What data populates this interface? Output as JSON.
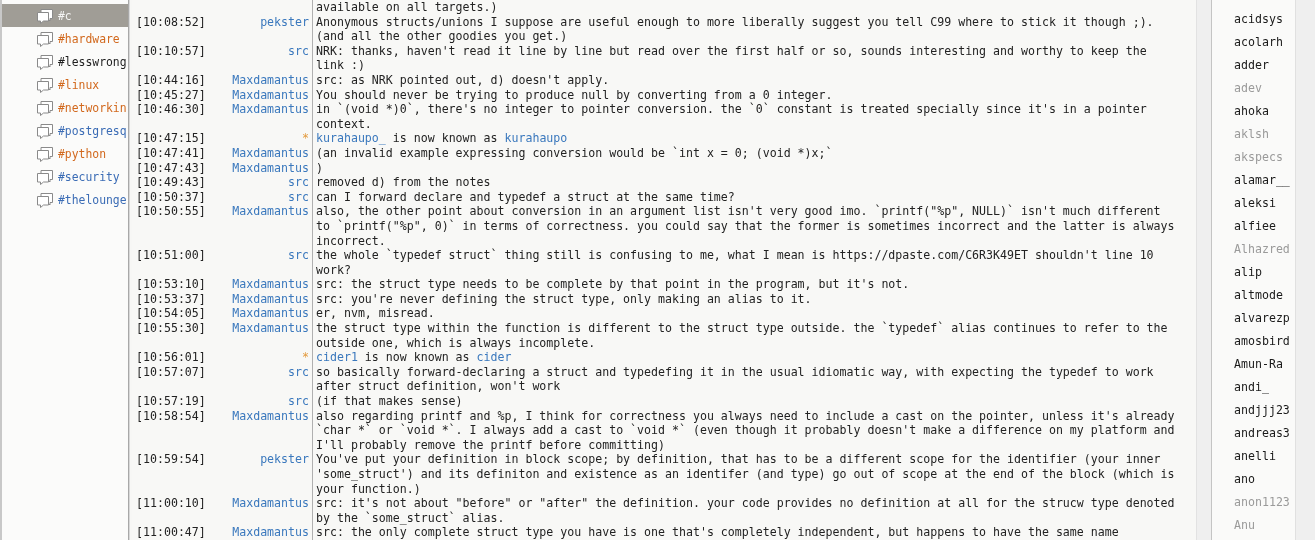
{
  "channels": [
    {
      "name": "#c",
      "selected": true
    },
    {
      "name": "#hardware",
      "selected": false,
      "color": "#d2691e"
    },
    {
      "name": "#lesswrong",
      "selected": false,
      "color": "#1e1e1e"
    },
    {
      "name": "#linux",
      "selected": false,
      "color": "#d2691e"
    },
    {
      "name": "#networkin",
      "selected": false,
      "color": "#d2691e"
    },
    {
      "name": "#postgresq",
      "selected": false,
      "color": "#3b6cb5"
    },
    {
      "name": "#python",
      "selected": false,
      "color": "#d2691e"
    },
    {
      "name": "#security",
      "selected": false,
      "color": "#3b6cb5"
    },
    {
      "name": "#thelounge",
      "selected": false,
      "color": "#3b6cb5"
    }
  ],
  "messages": [
    {
      "kind": "continuation",
      "text": "available on all targets.)"
    },
    {
      "kind": "message",
      "time": "[10:08:52]",
      "nick": "pekster",
      "text": "Anonymous structs/unions I suppose are useful enough to more liberally suggest you tell C99 where to stick it though ;). (and all the other goodies you get.)"
    },
    {
      "kind": "message",
      "time": "[10:10:57]",
      "nick": "src",
      "text": "NRK: thanks, haven't read it line by line but read over the first half or so, sounds interesting and worthy to keep the link :)"
    },
    {
      "kind": "message",
      "time": "[10:44:16]",
      "nick": "Maxdamantus",
      "text": "src: as NRK pointed out, d) doesn't apply."
    },
    {
      "kind": "message",
      "time": "[10:45:27]",
      "nick": "Maxdamantus",
      "text": "You should never be trying to produce null by converting from a 0 integer."
    },
    {
      "kind": "message",
      "time": "[10:46:30]",
      "nick": "Maxdamantus",
      "text": "in `(void *)0`, there's no integer to pointer conversion. the `0` constant is treated specially since it's in a pointer context."
    },
    {
      "kind": "nick_change",
      "time": "[10:47:15]",
      "nick": "*",
      "old": "kurahaupo_",
      "middle": "is now known as",
      "new": "kurahaupo"
    },
    {
      "kind": "message",
      "time": "[10:47:41]",
      "nick": "Maxdamantus",
      "text": "(an invalid example expressing conversion would be `int x = 0; (void *)x;`"
    },
    {
      "kind": "message",
      "time": "[10:47:43]",
      "nick": "Maxdamantus",
      "text": ")"
    },
    {
      "kind": "message",
      "time": "[10:49:43]",
      "nick": "src",
      "text": "removed d) from the notes"
    },
    {
      "kind": "message",
      "time": "[10:50:37]",
      "nick": "src",
      "text": "can I forward declare and typedef a struct at the same time?"
    },
    {
      "kind": "message",
      "time": "[10:50:55]",
      "nick": "Maxdamantus",
      "text": "also, the other point about conversion in an argument list isn't very good imo. `printf(\"%p\", NULL)` isn't much different to `printf(\"%p\", 0)` in terms of correctness. you could say that the former is sometimes incorrect and the latter is always incorrect."
    },
    {
      "kind": "message",
      "time": "[10:51:00]",
      "nick": "src",
      "text": "the whole `typedef struct` thing still is confusing to me, what I mean is https://dpaste.com/C6R3K49ET shouldn't line 10 work?"
    },
    {
      "kind": "message",
      "time": "[10:53:10]",
      "nick": "Maxdamantus",
      "text": "src: the struct type needs to be complete by that point in the program, but it's not."
    },
    {
      "kind": "message",
      "time": "[10:53:37]",
      "nick": "Maxdamantus",
      "text": "src: you're never defining the struct type, only making an alias to it."
    },
    {
      "kind": "message",
      "time": "[10:54:05]",
      "nick": "Maxdamantus",
      "text": "er, nvm, misread."
    },
    {
      "kind": "message",
      "time": "[10:55:30]",
      "nick": "Maxdamantus",
      "text": "the struct type within the function is different to the struct type outside. the `typedef` alias continues to refer to the outside one, which is always incomplete."
    },
    {
      "kind": "nick_change",
      "time": "[10:56:01]",
      "nick": "*",
      "old": "cider1",
      "middle": "is now known as",
      "new": "cider"
    },
    {
      "kind": "message",
      "time": "[10:57:07]",
      "nick": "src",
      "text": "so basically forward-declaring a struct and typedefing it in the usual idiomatic way, with expecting the typedef to work after struct definition, won't work"
    },
    {
      "kind": "message",
      "time": "[10:57:19]",
      "nick": "src",
      "text": "(if that makes sense)"
    },
    {
      "kind": "message",
      "time": "[10:58:54]",
      "nick": "Maxdamantus",
      "text": "also regarding printf and %p, I think for correctness you always need to include a cast on the pointer, unless it's already `char *` or `void *`. I always add a cast to `void *` (even though it probably doesn't make a difference on my platform and I'll probably remove the printf before committing)"
    },
    {
      "kind": "message",
      "time": "[10:59:54]",
      "nick": "pekster",
      "text": "You've put your definition in block scope; by definition, that has to be a different scope for the identifier (your inner 'some_struct') and its definiton and existence as an identifer (and type) go out of scope at the end of the block (which is your function.)"
    },
    {
      "kind": "message",
      "time": "[11:00:10]",
      "nick": "Maxdamantus",
      "text": "src: it's not about \"before\" or \"after\" the definition. your code provides no definition at all for the strucw type denoted by the `some_struct` alias."
    },
    {
      "kind": "message",
      "time": "[11:00:47]",
      "nick": "Maxdamantus",
      "text": "src: the only complete struct type you have is one that's completely independent, but happens to have the same name"
    }
  ],
  "users": [
    {
      "name": "acidsys",
      "away": false
    },
    {
      "name": "acolarh",
      "away": false
    },
    {
      "name": "adder",
      "away": false
    },
    {
      "name": "adev",
      "away": true
    },
    {
      "name": "ahoka",
      "away": false
    },
    {
      "name": "aklsh",
      "away": true
    },
    {
      "name": "akspecs",
      "away": true
    },
    {
      "name": "alamar__",
      "away": false
    },
    {
      "name": "aleksi",
      "away": false
    },
    {
      "name": "alfiee",
      "away": false
    },
    {
      "name": "Alhazred",
      "away": true
    },
    {
      "name": "alip",
      "away": false
    },
    {
      "name": "altmode",
      "away": false
    },
    {
      "name": "alvarezp",
      "away": false
    },
    {
      "name": "amosbird",
      "away": false
    },
    {
      "name": "Amun-Ra",
      "away": false
    },
    {
      "name": "andi_",
      "away": false
    },
    {
      "name": "andjjj23",
      "away": false
    },
    {
      "name": "andreas3",
      "away": false
    },
    {
      "name": "anelli",
      "away": false
    },
    {
      "name": "ano",
      "away": false
    },
    {
      "name": "anon1123",
      "away": true
    },
    {
      "name": "Anu",
      "away": true
    }
  ]
}
